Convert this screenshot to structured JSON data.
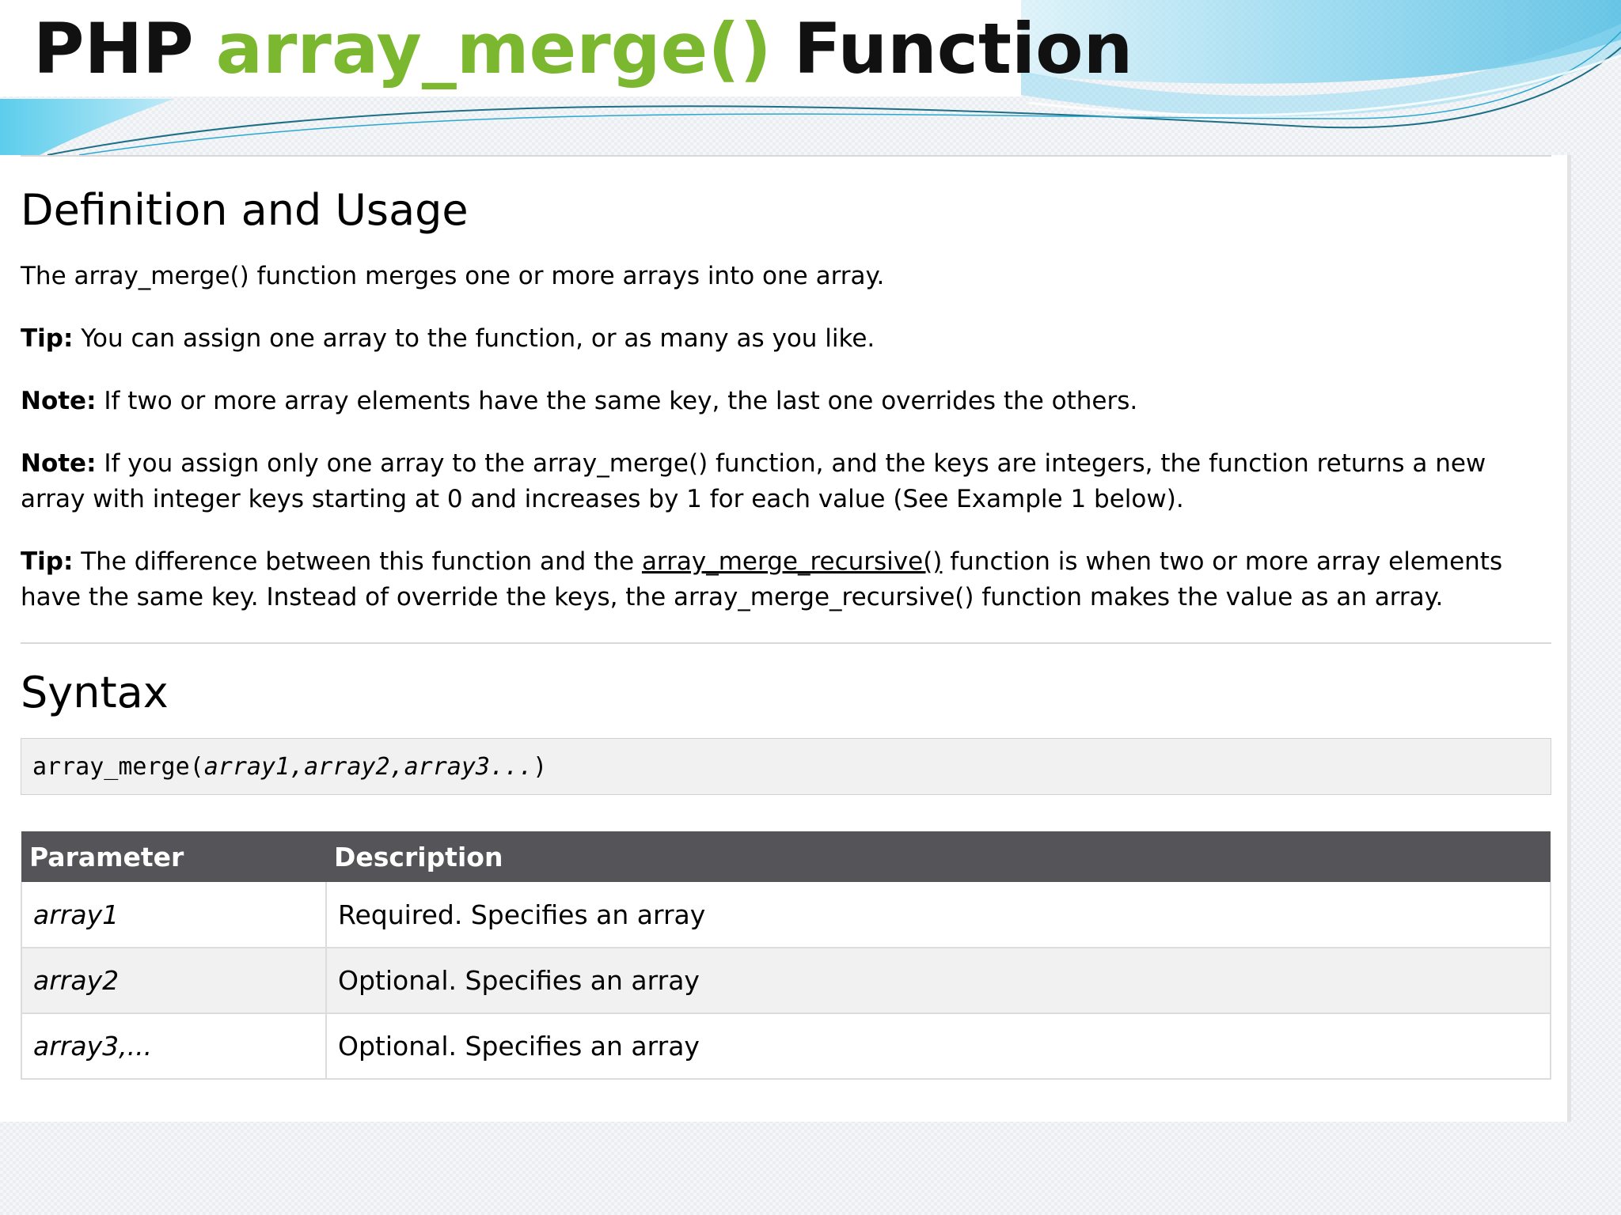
{
  "slide": {
    "title_prefix": "PHP",
    "title_function": "array_merge()",
    "title_suffix": "Function"
  },
  "definition": {
    "heading": "Definition and Usage",
    "intro": "The array_merge() function merges one or more arrays into one array.",
    "tip1_label": "Tip:",
    "tip1_text": "You can assign one array to the function, or as many as you like.",
    "note1_label": "Note:",
    "note1_text": "If two or more array elements have the same key, the last one overrides the others.",
    "note2_label": "Note:",
    "note2_text": "If you assign only one array to the array_merge() function, and the keys are integers, the function returns a new array with integer keys starting at 0 and increases by 1 for each value (See Example 1 below).",
    "tip2_label": "Tip:",
    "tip2_before": "The difference between this function and the",
    "tip2_link": "array_merge_recursive()",
    "tip2_after": "function is when two or more array elements have the same key. Instead of override the keys, the array_merge_recursive() function makes the value as an array."
  },
  "syntax": {
    "heading": "Syntax",
    "code_fn": "array_merge(",
    "code_args": "array1,array2,array3...",
    "code_close": ")"
  },
  "params_table": {
    "headers": [
      "Parameter",
      "Description"
    ],
    "rows": [
      {
        "name": "array1",
        "description": "Required. Specifies an array"
      },
      {
        "name": "array2",
        "description": "Optional. Specifies an array"
      },
      {
        "name": "array3,...",
        "description": "Optional. Specifies an array"
      }
    ]
  },
  "colors": {
    "function_green": "#7cb82f",
    "table_header": "#555559",
    "decor_blue": "#4fc3e8"
  }
}
